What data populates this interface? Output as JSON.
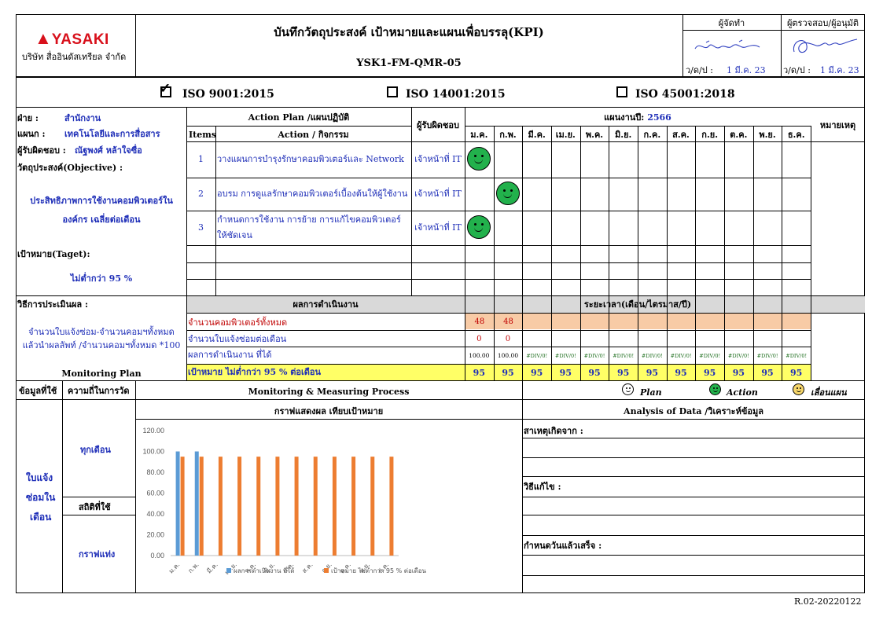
{
  "header": {
    "logo": "YASAKI",
    "company": "บริษัท สื่ออินดัสเทรียล จำกัด",
    "title": "บันทึกวัตถุประสงค์ เป้าหมายและแผนเพื่อบรรลุ(KPI)",
    "doc_code": "YSK1-FM-QMR-05",
    "prepared_label": "ผู้จัดทำ",
    "reviewer_label": "ผู้ตรวจสอบ/ผู้อนุมัติ",
    "date_label": "ว/ด/ป :",
    "prepared_date": "1 มี.ค. 23",
    "reviewer_date": "1 มี.ค. 23"
  },
  "iso": [
    "ISO 9001:2015",
    "ISO 14001:2015",
    "ISO 45001:2018"
  ],
  "left": {
    "dept_label": "ฝ่าย :",
    "dept_value": "สำนักงาน",
    "section_label": "แผนก :",
    "section_value": "เทคโนโลยีและการสื่อสาร",
    "owner_label": "ผู้รับผิดชอบ :",
    "owner_value": "ณัฐพงศ์ หล้าใจซื่อ",
    "objective_label": "วัตถุประสงค์(Objective) :",
    "objective_line1": "ประสิทธิภาพการใช้งานคอมพิวเตอร์ใน",
    "objective_line2": "องค์กร เฉลี่ยต่อเดือน",
    "target_label": "เป้าหมาย(Taget):",
    "target_value": "ไม่ต่ำกว่า 95 %",
    "method_label": "วิธีการประเมินผล :",
    "method_line1": "จำนวนใบแจ้งซ่อม-จำนวนคอมฯทั้งหมด",
    "method_line2": "แล้วนำผลลัพท์ /จำนวนคอมฯทั้งหมด *100",
    "monitoring_plan": "Monitoring Plan"
  },
  "action_plan": {
    "title": "Action Plan /แผนปฏิบัติ",
    "items_label": "Items",
    "action_label": "Action / กิจกรรม",
    "responsible_label": "ผู้รับผิดชอบ",
    "plan_year_label": "แผนงานปี:",
    "plan_year": "2566",
    "remark_label": "หมายเหตุ",
    "months": [
      "ม.ค.",
      "ก.พ.",
      "มี.ค.",
      "เม.ย.",
      "พ.ค.",
      "มิ.ย.",
      "ก.ค.",
      "ส.ค.",
      "ก.ย.",
      "ต.ค.",
      "พ.ย.",
      "ธ.ค."
    ],
    "rows": [
      {
        "no": "1",
        "action1": "วางแผนการบำรุงรักษาคอมพิวเตอร์และ Network",
        "action2": "",
        "resp": "เจ้าหน้าที่ IT",
        "action_month": 0
      },
      {
        "no": "2",
        "action1": "อบรม การดูแลรักษาคอมพิวเตอร์เบื้องต้นให้ผู้ใช้งาน",
        "action2": "",
        "resp": "เจ้าหน้าที่ IT",
        "action_month": 1
      },
      {
        "no": "3",
        "action1": "กำหนดการใช้งาน การย้าย การแก้ไขคอมพิวเตอร์",
        "action2": "ให้ชัดเจน",
        "resp": "เจ้าหน้าที่ IT",
        "action_month": 0
      }
    ]
  },
  "results": {
    "title": "ผลการดำเนินงาน",
    "period_title": "ระยะเวลา(เดือน/ไตรมาส/ปี)",
    "row1_label": "จำนวนคอมพิวเตอร์ทั้งหมด",
    "row1_values": [
      "48",
      "48"
    ],
    "row2_label": "จำนวนใบแจ้งซ่อมต่อเดือน",
    "row2_values": [
      "0",
      "0"
    ],
    "row3_label": "ผลการดำเนินงาน ที่ได้",
    "row3_values": [
      "100.00",
      "100.00",
      "#DIV/0!",
      "#DIV/0!",
      "#DIV/0!",
      "#DIV/0!",
      "#DIV/0!",
      "#DIV/0!",
      "#DIV/0!",
      "#DIV/0!",
      "#DIV/0!",
      "#DIV/0!"
    ],
    "row4_label": "เป้าหมาย ไม่ต่ำกว่า 95 % ต่อเดือน",
    "row4_values": [
      "95",
      "95",
      "95",
      "95",
      "95",
      "95",
      "95",
      "95",
      "95",
      "95",
      "95",
      "95"
    ]
  },
  "monitoring": {
    "data_used": "ข้อมูลที่ใช้",
    "frequency": "ความถี่ในการวัด",
    "process_title": "Monitoring & Measuring Process",
    "legend_plan": "Plan",
    "legend_action": "Action",
    "legend_delay": "เลื่อนแผน",
    "data_value_1": "ใบแจ้ง",
    "data_value_2": "ซ่อมใน",
    "data_value_3": "เดือน",
    "freq_value": "ทุกเดือน",
    "stat_label": "สถิติที่ใช้",
    "stat_value": "กราฟแท่ง",
    "chart_title": "กราฟแสดงผล เทียบเป้าหมาย",
    "analysis_title": "Analysis of Data /วิเคราะห์ข้อมูล",
    "cause_label": "สาเหตุเกิดจาก :",
    "fix_label": "วิธีแก้ไข :",
    "deadline_label": "กำหนดวันแล้วเสร็จ :"
  },
  "footer_code": "R.02-20220122",
  "chart_data": {
    "type": "bar",
    "title": "",
    "categories": [
      "ม.ค.",
      "ก.พ.",
      "มี.ค.",
      "เม.ย.",
      "พ.ค.",
      "มิ.ย.",
      "ก.ค.",
      "ส.ค.",
      "ก.ย.",
      "ต.ค.",
      "พ.ย.",
      "ธ.ค."
    ],
    "series": [
      {
        "name": "ผลการดำเนินงาน ที่ได้",
        "values": [
          100,
          100,
          null,
          null,
          null,
          null,
          null,
          null,
          null,
          null,
          null,
          null
        ],
        "color": "#5b9bd5"
      },
      {
        "name": "เป้าหมาย ไม่ต่ำกว่า 95 % ต่อเดือน",
        "values": [
          95,
          95,
          95,
          95,
          95,
          95,
          95,
          95,
          95,
          95,
          95,
          95
        ],
        "color": "#ed7d31"
      }
    ],
    "ylim": [
      0,
      120
    ],
    "yticks": [
      "0.00",
      "20.00",
      "40.00",
      "60.00",
      "80.00",
      "100.00",
      "120.00"
    ],
    "grid": false,
    "legend": "bottom"
  }
}
